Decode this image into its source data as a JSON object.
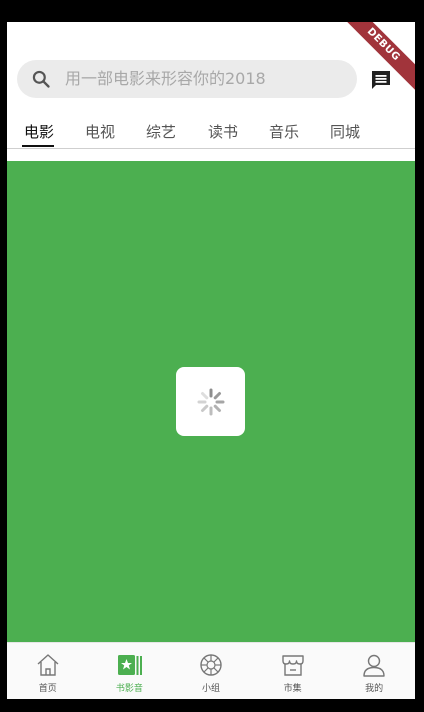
{
  "debug_banner": "DEBUG",
  "search": {
    "placeholder": "用一部电影来形容你的2018"
  },
  "tabs": [
    {
      "label": "电影",
      "active": true
    },
    {
      "label": "电视",
      "active": false
    },
    {
      "label": "综艺",
      "active": false
    },
    {
      "label": "读书",
      "active": false
    },
    {
      "label": "音乐",
      "active": false
    },
    {
      "label": "同城",
      "active": false
    }
  ],
  "content": {
    "background": "#4caf50",
    "state": "loading"
  },
  "bottom_nav": [
    {
      "label": "首页",
      "icon": "home-icon",
      "active": false
    },
    {
      "label": "书影音",
      "icon": "books-movies-music-icon",
      "active": true
    },
    {
      "label": "小组",
      "icon": "group-icon",
      "active": false
    },
    {
      "label": "市集",
      "icon": "market-icon",
      "active": false
    },
    {
      "label": "我的",
      "icon": "profile-icon",
      "active": false
    }
  ],
  "colors": {
    "accent": "#4caf50",
    "debug_banner": "#a1343b"
  }
}
